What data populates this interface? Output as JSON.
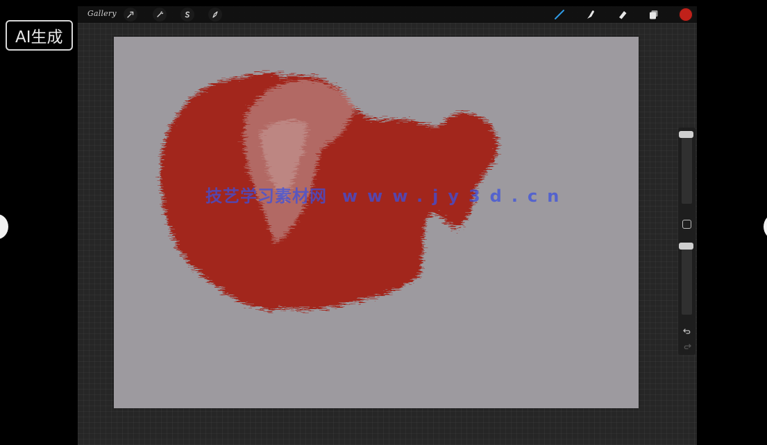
{
  "toolbar": {
    "gallery_label": "Gallery",
    "left_tools": [
      "wrench-icon",
      "magic-wand-icon",
      "selection-icon",
      "transform-icon"
    ],
    "right_tools": [
      "brush-icon",
      "smudge-icon",
      "eraser-icon",
      "layers-icon"
    ],
    "current_color": "#c0211a"
  },
  "watermark": {
    "cn_text": "技艺学习素材网",
    "url_text": "www.jy3d.cn"
  },
  "badge": {
    "text": "AI生成"
  },
  "colors": {
    "paint": "#a2261c",
    "canvas": "#9d9a9f",
    "accent_brush": "#2f9be6"
  }
}
